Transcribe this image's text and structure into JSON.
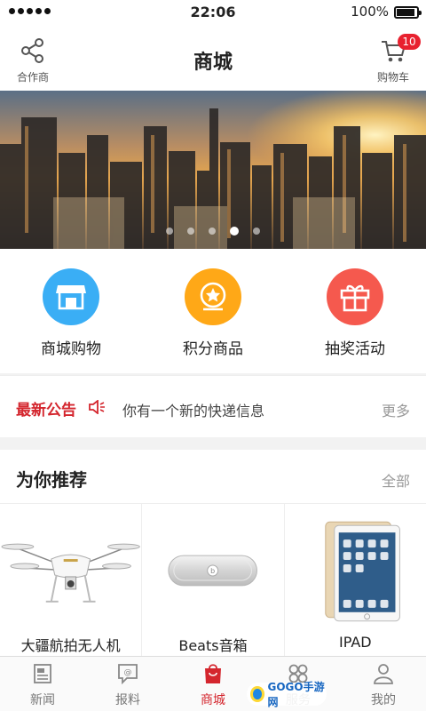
{
  "status": {
    "time": "22:06",
    "battery": "100%"
  },
  "nav": {
    "title": "商城",
    "left_label": "合作商",
    "cart_label": "购物车",
    "cart_count": "10"
  },
  "quick": [
    {
      "label": "商城购物",
      "icon": "shop-icon",
      "color": "#3aaef5"
    },
    {
      "label": "积分商品",
      "icon": "medal-icon",
      "color": "#ffa817"
    },
    {
      "label": "抽奖活动",
      "icon": "gift-icon",
      "color": "#f5594e"
    }
  ],
  "notice": {
    "title": "最新公告",
    "text": "你有一个新的快递信息",
    "more": "更多"
  },
  "recommend": {
    "title": "为你推荐",
    "all": "全部",
    "items": [
      {
        "name": "大疆航拍无人机",
        "icon": "drone-icon"
      },
      {
        "name": "Beats音箱",
        "icon": "speaker-icon"
      },
      {
        "name": "IPAD",
        "icon": "tablet-icon"
      }
    ]
  },
  "tabs": [
    {
      "label": "新闻",
      "icon": "newspaper-icon"
    },
    {
      "label": "报料",
      "icon": "report-icon"
    },
    {
      "label": "商城",
      "icon": "shopping-bag-icon",
      "active": true
    },
    {
      "label": "服务",
      "icon": "grid-icon"
    },
    {
      "label": "我的",
      "icon": "user-icon"
    }
  ],
  "watermark": {
    "text": "GOGO手游网"
  },
  "colors": {
    "accent": "#d4262e"
  }
}
